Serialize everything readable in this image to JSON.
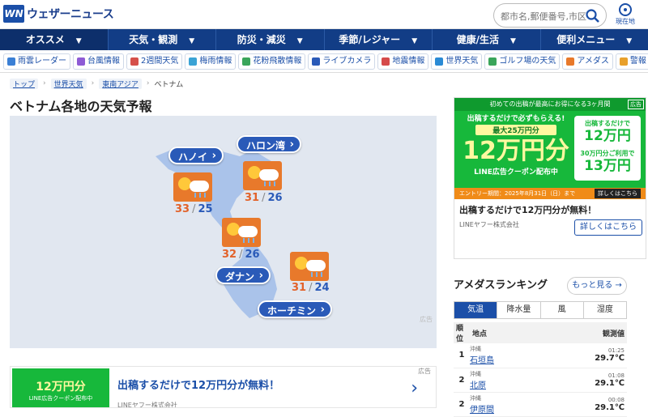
{
  "header": {
    "logo_text": "ウェザーニュース",
    "search_placeholder": "都市名,郵便番号,市区",
    "location_label": "現在地"
  },
  "nav": {
    "items": [
      {
        "label": "オススメ",
        "active": true
      },
      {
        "label": "天気・観測"
      },
      {
        "label": "防災・減災"
      },
      {
        "label": "季節/レジャー"
      },
      {
        "label": "健康/生活"
      },
      {
        "label": "便利メニュー"
      }
    ]
  },
  "subnav": {
    "items": [
      {
        "label": "雨雲レーダー",
        "icon": "rain-cloud-icon",
        "color": "#3a7fd5"
      },
      {
        "label": "台風情報",
        "icon": "typhoon-icon",
        "color": "#8e5bd5"
      },
      {
        "label": "2週間天気",
        "icon": "calendar-icon",
        "color": "#d5504a"
      },
      {
        "label": "梅雨情報",
        "icon": "umbrella-icon",
        "color": "#3aa3d5"
      },
      {
        "label": "花粉飛散情報",
        "icon": "tree-icon",
        "color": "#3aa55a"
      },
      {
        "label": "ライブカメラ",
        "icon": "camera-icon",
        "color": "#2a5ab8"
      },
      {
        "label": "地震情報",
        "icon": "earthquake-icon",
        "color": "#d54a4a"
      },
      {
        "label": "世界天気",
        "icon": "globe-icon",
        "color": "#2a8ad5"
      },
      {
        "label": "ゴルフ場の天気",
        "icon": "golf-icon",
        "color": "#3aa55a"
      },
      {
        "label": "アメダス",
        "icon": "amedas-icon",
        "color": "#e8792b"
      },
      {
        "label": "警報",
        "icon": "alert-icon",
        "color": "#e8a02b"
      }
    ]
  },
  "breadcrumb": {
    "items": [
      "トップ",
      "世界天気",
      "東南アジア"
    ],
    "current": "ベトナム"
  },
  "page_title": "ベトナム各地の天気予報",
  "map": {
    "cities": [
      {
        "name": "ハノイ",
        "hi": "33",
        "lo": "25"
      },
      {
        "name": "ハロン湾",
        "hi": "31",
        "lo": "26"
      },
      {
        "name": "ダナン",
        "hi": "32",
        "lo": "26"
      },
      {
        "name": "ホーチミン",
        "hi": "31",
        "lo": "24"
      }
    ],
    "ad_marker": "広告"
  },
  "ad_side": {
    "badge": "広告",
    "top_text": "初めての出稿が最高にお得になる3ヶ月間",
    "lead": "出稿するだけで必ずもらえる!",
    "max": "最大25万円分",
    "big": "12万円分",
    "sub": "LINE広告クーポン配布中",
    "right_top": "出稿するだけで",
    "right_n1": "12万円",
    "right_mid": "30万円分ご利用で",
    "right_n2": "13万円",
    "bottom": "エントリー期間：2025年8月31日（日）まで",
    "bottom_btn": "詳しくはこちら",
    "title": "出稿するだけで12万円分が無料！",
    "company": "LINEヤフー株式会社",
    "button": "詳しくはこちら"
  },
  "ranking": {
    "title": "アメダスランキング",
    "more": "もっと見る",
    "tabs": [
      "気温",
      "降水量",
      "風",
      "湿度"
    ],
    "active_tab": 0,
    "columns": [
      "順位",
      "地点",
      "観測値"
    ],
    "rows": [
      {
        "rank": "1",
        "pref": "沖縄",
        "place": "石垣島",
        "time": "01:25",
        "value": "29.7℃"
      },
      {
        "rank": "2",
        "pref": "沖縄",
        "place": "北原",
        "time": "01:08",
        "value": "29.1℃"
      },
      {
        "rank": "2",
        "pref": "沖縄",
        "place": "伊原間",
        "time": "00:08",
        "value": "29.1℃"
      }
    ]
  },
  "ad_bottom": {
    "badge": "広告",
    "thumb_big": "12万円分",
    "thumb_sub": "LINE広告クーポン配布中",
    "title": "出稿するだけで12万円分が無料！",
    "company": "LINEヤフー株式会社"
  },
  "colors": {
    "brand": "#1b4fa8",
    "nav": "#123d86",
    "high_temp": "#e2622a",
    "low_temp": "#2a5ab8",
    "ad_green": "#17b83b"
  }
}
